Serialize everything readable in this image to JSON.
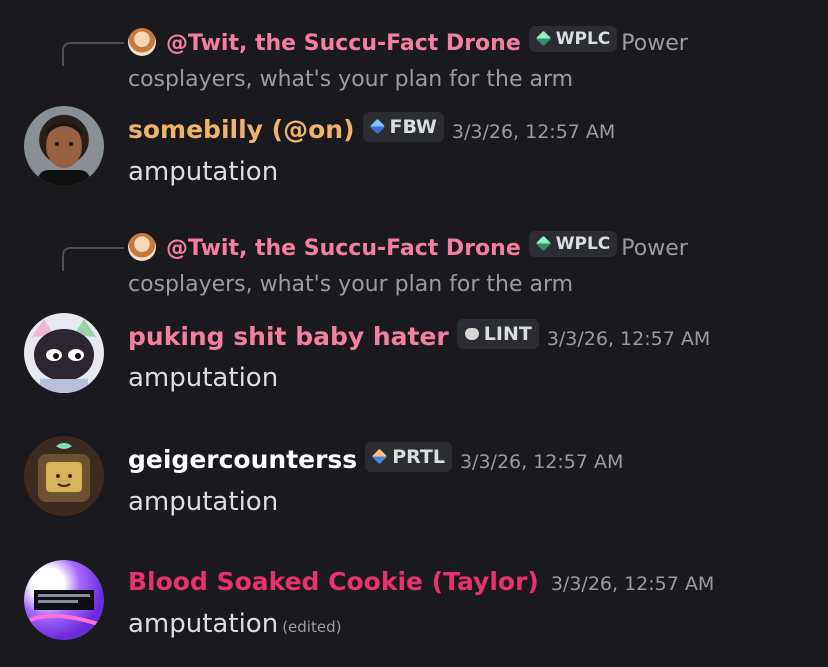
{
  "reply_preview": {
    "author": "@Twit, the Succu-Fact Drone",
    "tag": "WPLC",
    "text_inline": "Power",
    "text_rest": "cosplayers, what's your plan for the arm"
  },
  "messages": [
    {
      "author": "somebilly (@on)",
      "author_color": "#f0b36b",
      "tag": "FBW",
      "timestamp": "3/3/26, 12:57 AM",
      "content": "amputation",
      "edited": ""
    },
    {
      "author": "puking shit baby hater",
      "author_color": "#f47fa0",
      "tag": "LINT",
      "timestamp": "3/3/26, 12:57 AM",
      "content": "amputation",
      "edited": ""
    },
    {
      "author": "geigercounterss",
      "author_color": "#ffffff",
      "tag": "PRTL",
      "timestamp": "3/3/26, 12:57 AM",
      "content": "amputation",
      "edited": ""
    },
    {
      "author": "Blood Soaked Cookie (Taylor)",
      "author_color": "#e6336b",
      "tag": "",
      "timestamp": "3/3/26, 12:57 AM",
      "content": "amputation",
      "edited": "(edited)"
    }
  ]
}
